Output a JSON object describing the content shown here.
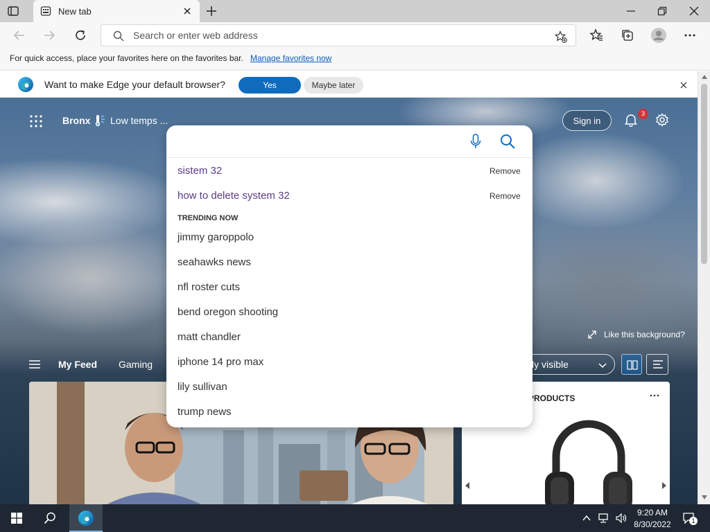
{
  "window": {
    "tab_title": "New tab"
  },
  "toolbar": {
    "address_placeholder": "Search or enter web address"
  },
  "favorites_bar": {
    "message": "For quick access, place your favorites here on the favorites bar.",
    "manage_link": "Manage favorites now"
  },
  "infobar": {
    "message": "Want to make Edge your default browser?",
    "yes_label": "Yes",
    "later_label": "Maybe later"
  },
  "ntp": {
    "location": "Bronx",
    "weather": "Low temps ...",
    "sign_in_label": "Sign in",
    "notification_count": "3",
    "like_background": "Like this background?",
    "feed_tabs": [
      "My Feed",
      "Gaming"
    ],
    "visibility_label": "ly visible",
    "shopping_card_title": "PRODUCTS"
  },
  "search_panel": {
    "history": [
      {
        "text": "sistem 32",
        "action": "Remove"
      },
      {
        "text": "how to delete system 32",
        "action": "Remove"
      }
    ],
    "trending_heading": "TRENDING NOW",
    "trending": [
      "jimmy garoppolo",
      "seahawks news",
      "nfl roster cuts",
      "bend oregon shooting",
      "matt chandler",
      "iphone 14 pro max",
      "lily sullivan",
      "trump news"
    ]
  },
  "taskbar": {
    "time": "9:20 AM",
    "date": "8/30/2022",
    "notification_count": "1"
  },
  "colors": {
    "accent": "#0f6cbd",
    "history_text": "#5a3c87",
    "taskbar": "#1e2732"
  }
}
